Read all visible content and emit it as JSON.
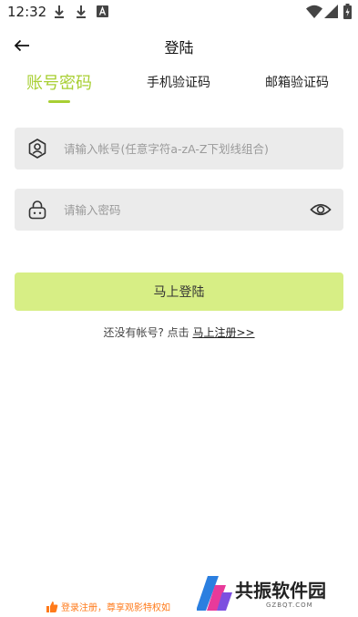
{
  "status_bar": {
    "time": "12:32",
    "left_icons": [
      "download-icon",
      "download-icon",
      "font-a-icon"
    ],
    "right_icons": [
      "wifi-icon",
      "signal-icon",
      "battery-icon"
    ]
  },
  "header": {
    "title": "登陆",
    "back_icon": "arrow-left-icon"
  },
  "tabs": [
    {
      "label": "账号密码",
      "active": true
    },
    {
      "label": "手机验证码",
      "active": false
    },
    {
      "label": "邮箱验证码",
      "active": false
    }
  ],
  "form": {
    "account": {
      "value": "",
      "placeholder": "请输入帐号(任意字符a-zA-Z下划线组合)",
      "icon": "user-shield-icon"
    },
    "password": {
      "value": "",
      "placeholder": "请输入密码",
      "icon": "lock-icon",
      "toggle_icon": "eye-icon"
    }
  },
  "login_button": {
    "label": "马上登陆"
  },
  "register": {
    "prompt": "还没有帐号? 点击 ",
    "link": "马上注册>>"
  },
  "footer": {
    "promo": "登录注册，尊享观影特权如",
    "promo_icon": "thumbs-up-icon",
    "watermark_text": "共振软件园",
    "watermark_sub": "GZBQT.COM"
  },
  "colors": {
    "accent": "#a8cf33",
    "button_bg": "#d7ee85",
    "field_bg": "#ebebeb",
    "promo": "#ff7a1a"
  }
}
